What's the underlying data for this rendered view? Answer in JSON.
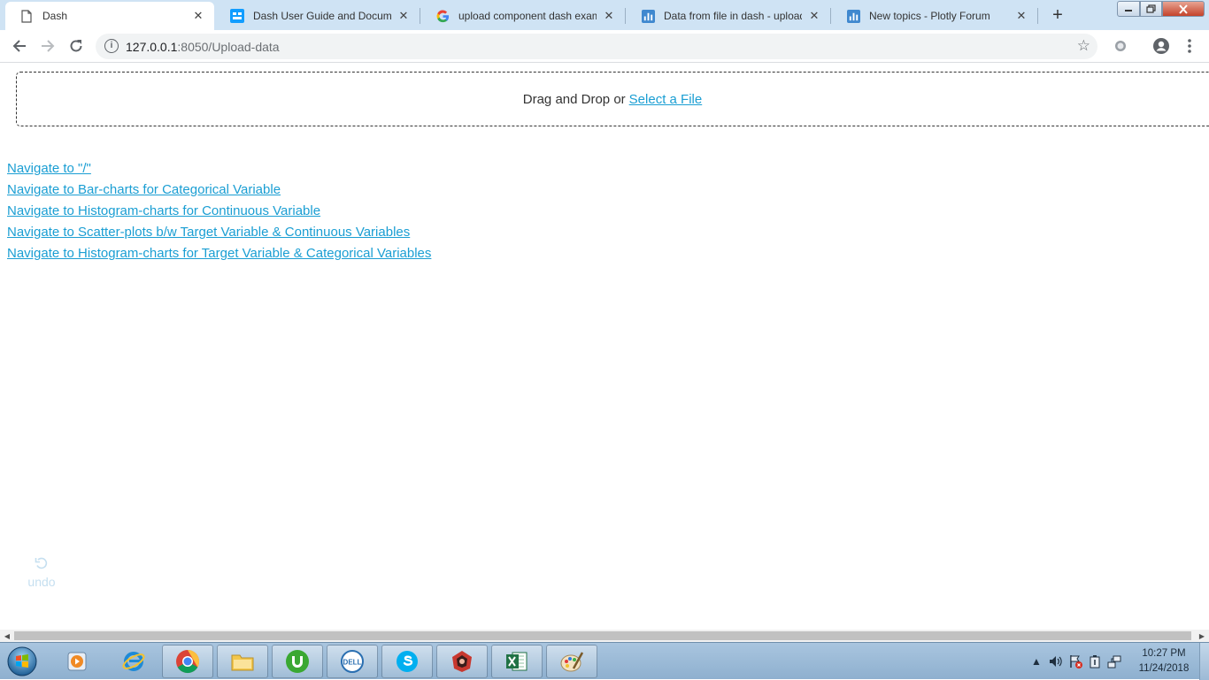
{
  "browser": {
    "tabs": [
      {
        "title": "Dash",
        "favicon": "page-icon",
        "active": true
      },
      {
        "title": "Dash User Guide and Document",
        "favicon": "dash-icon",
        "active": false
      },
      {
        "title": "upload component dash examp",
        "favicon": "google-icon",
        "active": false
      },
      {
        "title": "Data from file in dash - upload",
        "favicon": "plotly-forum-icon",
        "active": false
      },
      {
        "title": "New topics - Plotly Forum",
        "favicon": "plotly-forum-icon",
        "active": false
      }
    ],
    "new_tab_label": "+",
    "url_host": "127.0.0.1",
    "url_rest": ":8050/Upload-data"
  },
  "page": {
    "upload": {
      "prefix": "Drag and Drop or",
      "link": "Select a File"
    },
    "links": [
      "Navigate to \"/\"",
      "Navigate to Bar-charts for Categorical Variable",
      "Navigate to Histogram-charts for Continuous Variable",
      "Navigate to Scatter-plots b/w Target Variable & Continuous Variables",
      "Navigate to Histogram-charts for Target Variable & Categorical Variables"
    ],
    "undo_label": "undo"
  },
  "taskbar": {
    "apps": [
      "start-orb-icon",
      "media-player-icon",
      "internet-explorer-icon",
      "chrome-icon",
      "file-explorer-icon",
      "utorrent-icon",
      "dell-icon",
      "skype-icon",
      "app-icon",
      "excel-icon",
      "paint-icon"
    ],
    "clock_time": "10:27 PM",
    "clock_date": "11/24/2018"
  },
  "colors": {
    "link": "#1a9ed3",
    "titlebar": "#cfe3f4",
    "taskbar": "#9dbcd9"
  }
}
